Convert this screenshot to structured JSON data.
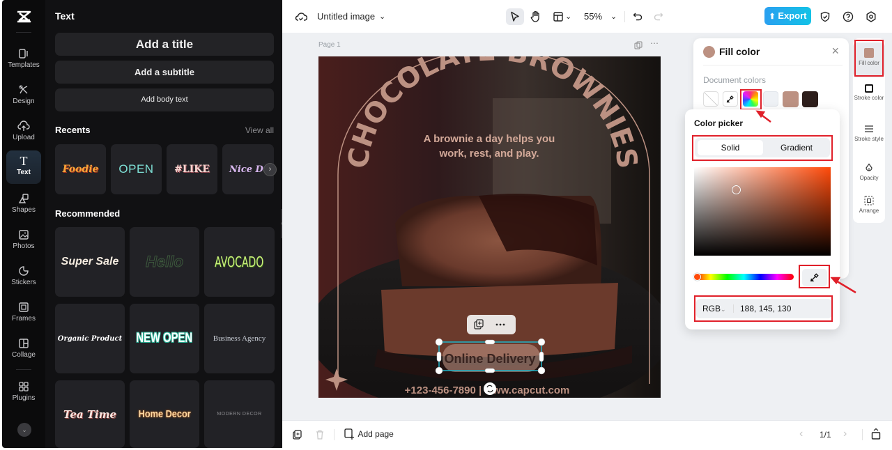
{
  "app": {
    "logo": "capcut-logo"
  },
  "rail": {
    "items": [
      {
        "label": "Templates",
        "icon": "templates-icon"
      },
      {
        "label": "Design",
        "icon": "design-icon"
      },
      {
        "label": "Upload",
        "icon": "upload-icon"
      },
      {
        "label": "Text",
        "icon": "text-icon",
        "active": true
      },
      {
        "label": "Shapes",
        "icon": "shapes-icon"
      },
      {
        "label": "Photos",
        "icon": "photos-icon"
      },
      {
        "label": "Stickers",
        "icon": "stickers-icon"
      },
      {
        "label": "Frames",
        "icon": "frames-icon"
      },
      {
        "label": "Collage",
        "icon": "collage-icon"
      },
      {
        "label": "Plugins",
        "icon": "plugins-icon"
      }
    ]
  },
  "panel": {
    "title": "Text",
    "add_title": "Add a title",
    "add_subtitle": "Add a subtitle",
    "add_body": "Add body text",
    "recents_title": "Recents",
    "view_all": "View all",
    "recents": [
      {
        "label": "Foodie",
        "color": "#f6a53a"
      },
      {
        "label": "OPEN",
        "color": "#7fe3d8"
      },
      {
        "label": "#LIKE",
        "color": "#f5d5d0"
      },
      {
        "label": "Nice Day",
        "color": "#d9b8f0"
      }
    ],
    "recommended_title": "Recommended",
    "recommended": [
      {
        "label": "Super Sale",
        "color": "#f5ece0"
      },
      {
        "label": "Hello",
        "color": "#2f3b2f"
      },
      {
        "label": "AVOCADO",
        "color": "#c9f07a"
      },
      {
        "label": "Organic Product",
        "color": "#ffffff"
      },
      {
        "label": "NEW OPEN",
        "color": "#ffffff"
      },
      {
        "label": "Business Agency",
        "color": "#c9ced6"
      },
      {
        "label": "Tea Time",
        "color": "#fbe6e0"
      },
      {
        "label": "Home Decor",
        "color": "#ffd9a3"
      },
      {
        "label": "MODERN DECOR",
        "color": "#8a8a8e"
      }
    ]
  },
  "topbar": {
    "doc_title": "Untitled image",
    "zoom": "55%",
    "export_label": "Export"
  },
  "workspace": {
    "page_label": "Page 1",
    "canvas": {
      "headline": "CHOCOLATE BROWNIES",
      "tagline_1": "A brownie a day helps you",
      "tagline_2": "work, rest, and play.",
      "selected_text": "Online Delivery",
      "footer": "+123-456-7890  |  www.capcut.com"
    }
  },
  "bottom": {
    "add_page": "Add page",
    "page_count": "1/1"
  },
  "fill_panel": {
    "title": "Fill color",
    "current_color": "#bc9182",
    "document_colors_label": "Document colors",
    "swatches": [
      {
        "name": "no-color",
        "color": "#ffffff"
      },
      {
        "name": "eyedropper",
        "color": "#ffffff"
      },
      {
        "name": "color-wheel",
        "color": "rainbow"
      },
      {
        "name": "light-gray",
        "color": "#eef1f5"
      },
      {
        "name": "rose-brown",
        "color": "#bc9182"
      },
      {
        "name": "dark-brown",
        "color": "#2d1e1b"
      }
    ]
  },
  "color_picker": {
    "title": "Color picker",
    "tabs": [
      "Solid",
      "Gradient"
    ],
    "active_tab": "Solid",
    "mode": "RGB",
    "value": "188, 145, 130"
  },
  "properties": {
    "items": [
      {
        "label": "Fill color",
        "active": true
      },
      {
        "label": "Stroke color"
      },
      {
        "label": "Stroke style"
      },
      {
        "label": "Opacity"
      },
      {
        "label": "Arrange"
      }
    ]
  }
}
